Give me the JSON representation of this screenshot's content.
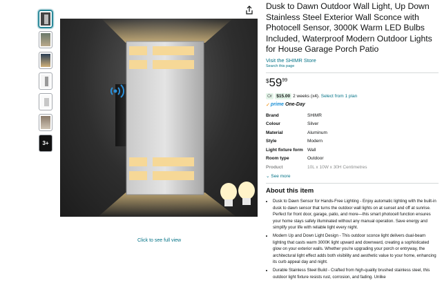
{
  "title": "Dusk to Dawn Outdoor Wall Light, Up Down Stainless Steel Exterior Wall Sconce with Photocell Sensor, 3000K Warm LED Bulbs Included, Waterproof Modern Outdoor Lights for House Garage Porch Patio",
  "store_link": "Visit the SHIMR Store",
  "search_link": "Search this page",
  "price": {
    "symbol": "$",
    "whole": "59",
    "fraction": "99"
  },
  "offer": {
    "or": "Or",
    "amount": "$15.00",
    "terms": "2 weeks (x4).",
    "select": "Select from 1 plan"
  },
  "prime": {
    "label": "prime",
    "one_day": "One-Day"
  },
  "specs": [
    {
      "key": "Brand",
      "value": "SHIMR"
    },
    {
      "key": "Colour",
      "value": "Silver"
    },
    {
      "key": "Material",
      "value": "Aluminum"
    },
    {
      "key": "Style",
      "value": "Modern"
    },
    {
      "key": "Light fixture form",
      "value": "Wall"
    },
    {
      "key": "Room type",
      "value": "Outdoor"
    },
    {
      "key": "Product",
      "value": "10L x 10W x 30H Centimetres"
    }
  ],
  "see_more": "See more",
  "about_title": "About this item",
  "bullets": [
    "Dusk to Dawn Sensor for Hands-Free Lighting - Enjoy automatic lighting with the built-in dusk to dawn sensor that turns the outdoor wall lights on at sunset and off at sunrise. Perfect for front door, garage, patio, and more—this smart photocell function ensures your home stays safely illuminated without any manual operation. Save energy and simplify your life with reliable light every night.",
    "Modern Up and Down Light Design - This outdoor sconce light delivers dual-beam lighting that casts warm 3000K light upward and downward, creating a sophisticated glow on your exterior walls. Whether you're upgrading your porch or entryway, the architectural light effect adds both visibility and aesthetic value to your home, enhancing its curb appeal day and night.",
    "Durable Stainless Steel Build - Crafted from high-quality brushed stainless steel, this outdoor light fixture resists rust, corrosion, and fading. Unlike"
  ],
  "thumb_more": "3+",
  "click_full": "Click to see full view",
  "icons": {
    "share": "share-icon",
    "wifi": "sensor-wifi-icon",
    "bulb": "led-bulb-icon"
  },
  "colors": {
    "link": "#007185",
    "prime": "#1a8fd6",
    "deal_bg": "#e3f4e8"
  }
}
